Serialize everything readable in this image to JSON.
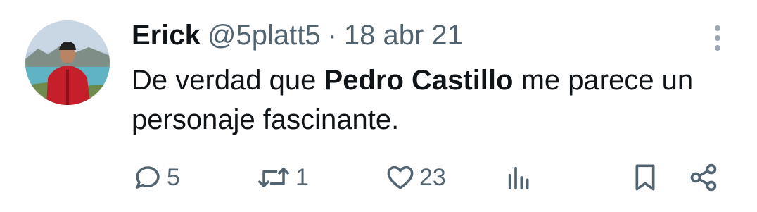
{
  "tweet": {
    "display_name": "Erick",
    "handle": "@5platt5",
    "separator": "·",
    "date": "18 abr 21",
    "text_before": "De verdad que ",
    "text_bold": "Pedro Castillo",
    "text_after": " me parece un personaje fascinante."
  },
  "actions": {
    "replies": "5",
    "retweets": "1",
    "likes": "23"
  },
  "colors": {
    "text_primary": "#0f1419",
    "text_secondary": "#536471",
    "background": "#ffffff"
  },
  "icons": {
    "more": "more-vertical-icon",
    "reply": "reply-icon",
    "retweet": "retweet-icon",
    "like": "heart-icon",
    "views": "views-icon",
    "bookmark": "bookmark-icon",
    "share": "share-icon"
  }
}
